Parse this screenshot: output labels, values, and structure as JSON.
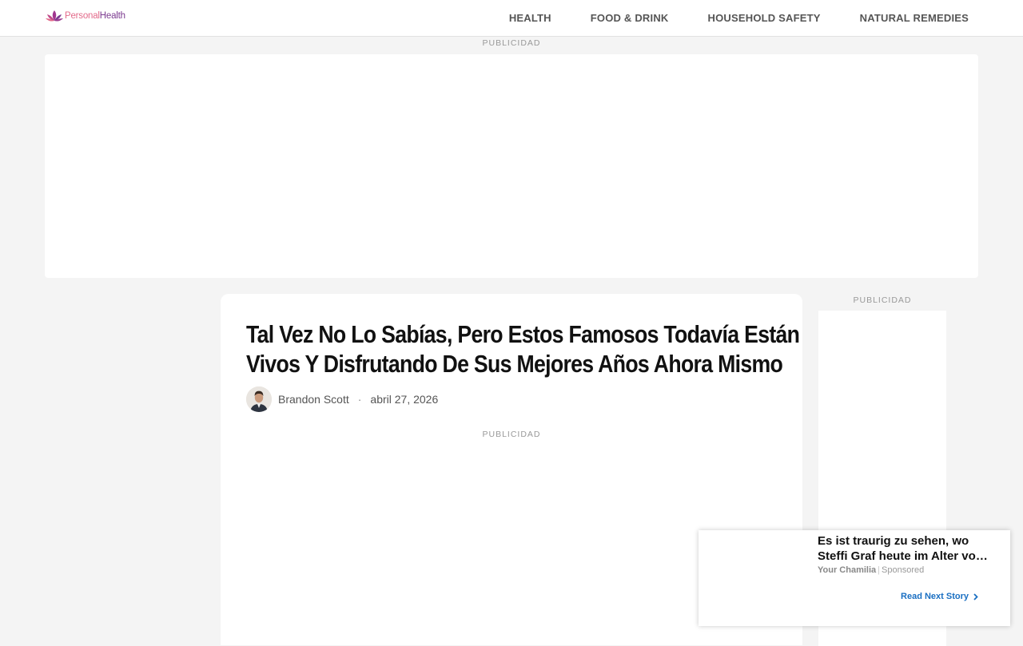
{
  "header": {
    "logo": {
      "part1": "Personal",
      "part2": "Health"
    },
    "nav": [
      "HEALTH",
      "FOOD & DRINK",
      "HOUSEHOLD SAFETY",
      "NATURAL REMEDIES"
    ]
  },
  "ads": {
    "top_label": "PUBLICIDAD",
    "side_label": "PUBLICIDAD",
    "mid_label": "PUBLICIDAD"
  },
  "article": {
    "title_line1": "Tal Vez No Lo Sabías, Pero Estos Famosos Todavía Están",
    "title_line2": "Vivos Y Disfrutando De Sus Mejores Años Ahora Mismo",
    "author": "Brandon Scott",
    "separator": "·",
    "date": "abril 27, 2026"
  },
  "widget": {
    "title": "Es ist traurig zu sehen, wo Steffi Graf heute im Alter vo…",
    "source": "Your Chamilia",
    "sponsored": "Sponsored",
    "read_next": "Read Next Story"
  },
  "colors": {
    "accent": "#1a6fc2",
    "logo_pink": "#e36a8a",
    "logo_purple": "#7b3a8f"
  },
  "icons": [
    "lotus-logo-icon",
    "chevron-right-icon"
  ]
}
